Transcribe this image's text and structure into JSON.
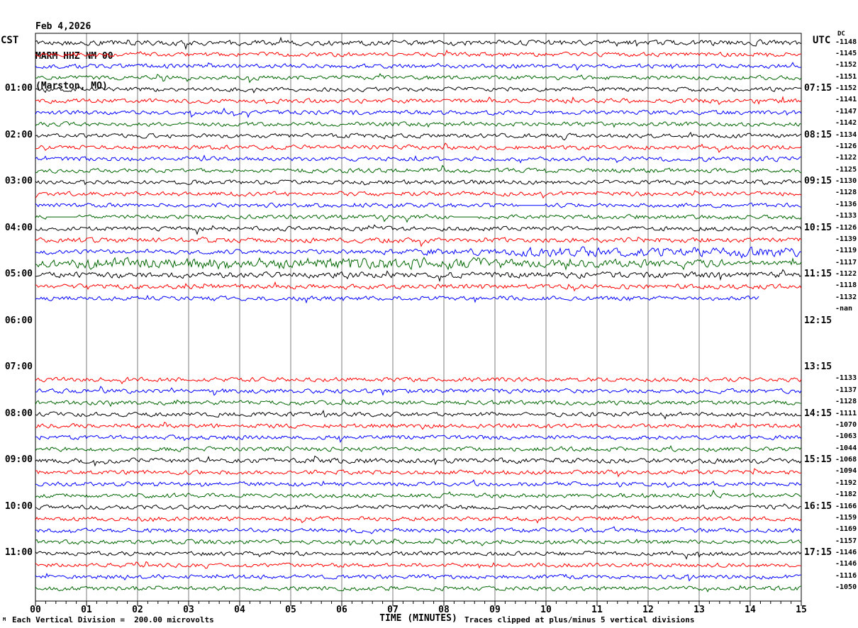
{
  "header": {
    "date": "Feb 4,2026",
    "station": "MARM HHZ NM 00",
    "location": "(Marston, MO)"
  },
  "axes": {
    "left_tz": "CST",
    "right_tz": "UTC",
    "dc_header": "DC",
    "x_label": "TIME (MINUTES)",
    "x_ticks": [
      "00",
      "01",
      "02",
      "03",
      "04",
      "05",
      "06",
      "07",
      "08",
      "09",
      "10",
      "11",
      "12",
      "13",
      "14",
      "15"
    ],
    "minor_ticks_per_minute": 5
  },
  "footer": {
    "corner_mark": "M",
    "left_note": "Each Vertical Division =  200.00 microvolts",
    "right_note": "Traces clipped at plus/minus 5 vertical divisions"
  },
  "colors": {
    "k": "#000000",
    "r": "#ff0000",
    "b": "#0000ff",
    "g": "#006600",
    "grid": "#7d7d7d",
    "border": "#000000",
    "bg": "#ffffff"
  },
  "chart_data": {
    "type": "line",
    "title": "MARM HHZ NM 00 helicorder, Feb 4,2026 (Marston, MO)",
    "x_range_minutes": [
      0,
      15
    ],
    "trace_colors_cycle": [
      "black",
      "red",
      "blue",
      "green"
    ],
    "hours": [
      {
        "left": "",
        "right": ""
      },
      {
        "left": "01:00",
        "right": "07:15"
      },
      {
        "left": "02:00",
        "right": "08:15"
      },
      {
        "left": "03:00",
        "right": "09:15"
      },
      {
        "left": "04:00",
        "right": "10:15"
      },
      {
        "left": "05:00",
        "right": "11:15"
      },
      {
        "left": "06:00",
        "right": "12:15"
      },
      {
        "left": "07:00",
        "right": "13:15"
      },
      {
        "left": "08:00",
        "right": "14:15"
      },
      {
        "left": "09:00",
        "right": "15:15"
      },
      {
        "left": "10:00",
        "right": "16:15"
      },
      {
        "left": "11:00",
        "right": "17:15"
      }
    ],
    "rows": [
      {
        "c": "k",
        "dc": "-1148",
        "amp": 1.2
      },
      {
        "c": "r",
        "dc": "-1145"
      },
      {
        "c": "b",
        "dc": "-1152"
      },
      {
        "c": "g",
        "dc": "-1151"
      },
      {
        "c": "k",
        "dc": "-1152"
      },
      {
        "c": "r",
        "dc": "-1141"
      },
      {
        "c": "b",
        "dc": "-1147"
      },
      {
        "c": "g",
        "dc": "-1142"
      },
      {
        "c": "k",
        "dc": "-1134"
      },
      {
        "c": "r",
        "dc": "-1126"
      },
      {
        "c": "b",
        "dc": "-1122"
      },
      {
        "c": "g",
        "dc": "-1125"
      },
      {
        "c": "k",
        "dc": "-1130"
      },
      {
        "c": "r",
        "dc": "-1128"
      },
      {
        "c": "b",
        "dc": "-1136",
        "flats": [
          [
            0.63,
            0.665
          ]
        ]
      },
      {
        "c": "g",
        "dc": "-1133",
        "flats": [
          [
            0.013,
            0.055
          ],
          [
            0.545,
            0.578
          ]
        ]
      },
      {
        "c": "k",
        "dc": "-1126"
      },
      {
        "c": "r",
        "dc": "-1139",
        "amp": 1.15
      },
      {
        "c": "b",
        "dc": "-1119",
        "amps": [
          [
            0,
            0.45,
            1.05
          ],
          [
            0.45,
            0.62,
            1.5
          ],
          [
            0.62,
            1,
            2.2
          ]
        ]
      },
      {
        "c": "g",
        "dc": "-1117",
        "amps": [
          [
            0,
            0.07,
            2.0
          ],
          [
            0.07,
            0.62,
            2.7
          ],
          [
            0.62,
            0.9,
            1.8
          ],
          [
            0.9,
            1,
            1.1
          ]
        ]
      },
      {
        "c": "k",
        "dc": "-1122",
        "amp": 1.35
      },
      {
        "c": "r",
        "dc": "-1118",
        "amp": 1.1
      },
      {
        "c": "b",
        "dc": "-1132",
        "end": 0.945
      },
      {
        "c": "g",
        "dc": "-nan",
        "present": false
      },
      {
        "c": "k",
        "dc": "",
        "present": false
      },
      {
        "c": "r",
        "dc": "",
        "present": false
      },
      {
        "c": "b",
        "dc": "",
        "present": false
      },
      {
        "c": "g",
        "dc": "",
        "present": false
      },
      {
        "c": "k",
        "dc": "",
        "present": false
      },
      {
        "c": "r",
        "dc": "-1133"
      },
      {
        "c": "b",
        "dc": "-1137"
      },
      {
        "c": "g",
        "dc": "-1128"
      },
      {
        "c": "k",
        "dc": "-1111"
      },
      {
        "c": "r",
        "dc": "-1070"
      },
      {
        "c": "b",
        "dc": "-1063"
      },
      {
        "c": "g",
        "dc": "-1044"
      },
      {
        "c": "k",
        "dc": "-1068",
        "amp": 1.15
      },
      {
        "c": "r",
        "dc": "-1094"
      },
      {
        "c": "b",
        "dc": "-1192"
      },
      {
        "c": "g",
        "dc": "-1182"
      },
      {
        "c": "k",
        "dc": "-1166"
      },
      {
        "c": "r",
        "dc": "-1159"
      },
      {
        "c": "b",
        "dc": "-1169"
      },
      {
        "c": "g",
        "dc": "-1157"
      },
      {
        "c": "k",
        "dc": "-1146"
      },
      {
        "c": "r",
        "dc": "-1146"
      },
      {
        "c": "b",
        "dc": "-1116"
      },
      {
        "c": "g",
        "dc": "-1050"
      }
    ]
  }
}
